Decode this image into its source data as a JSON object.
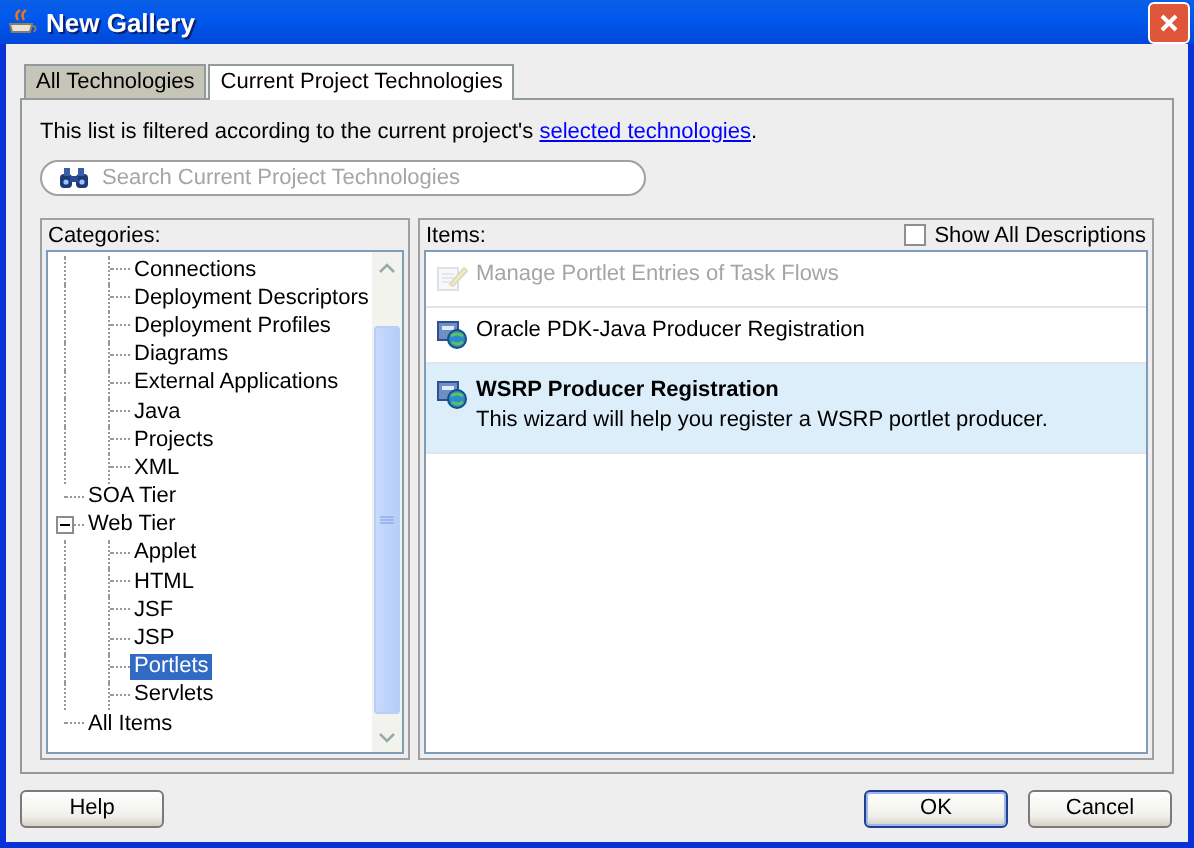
{
  "window": {
    "title": "New Gallery"
  },
  "tabs": [
    {
      "label": "All Technologies",
      "selected": false
    },
    {
      "label": "Current Project Technologies",
      "selected": true
    }
  ],
  "filter_note": {
    "text": "This list is filtered according to the current project's ",
    "link": "selected technologies",
    "end": "."
  },
  "search": {
    "placeholder": "Search Current Project Technologies"
  },
  "categories": {
    "label": "Categories:",
    "tree": [
      {
        "children": [
          {
            "label": "Connections",
            "selected": false
          },
          {
            "label": "Deployment Descriptors",
            "selected": false
          },
          {
            "label": "Deployment Profiles",
            "selected": false
          },
          {
            "label": "Diagrams",
            "selected": false
          },
          {
            "label": "External Applications",
            "selected": false
          },
          {
            "label": "Java",
            "selected": false
          },
          {
            "label": "Projects",
            "selected": false
          },
          {
            "label": "XML",
            "selected": false
          }
        ]
      },
      {
        "label": "SOA Tier",
        "selected": false
      },
      {
        "label": "Web Tier",
        "selected": false,
        "expanded": true,
        "children": [
          {
            "label": "Applet",
            "selected": false
          },
          {
            "label": "HTML",
            "selected": false
          },
          {
            "label": "JSF",
            "selected": false
          },
          {
            "label": "JSP",
            "selected": false
          },
          {
            "label": "Portlets",
            "selected": true
          },
          {
            "label": "Servlets",
            "selected": false
          }
        ]
      },
      {
        "label": "All Items",
        "selected": false
      }
    ]
  },
  "items": {
    "label": "Items:",
    "show_all_descriptions": {
      "label": "Show All Descriptions",
      "checked": false
    },
    "list": [
      {
        "kind": "task",
        "title": "Manage Portlet Entries of Task Flows",
        "disabled": true,
        "selected": false
      },
      {
        "kind": "producer",
        "title": "Oracle PDK-Java Producer Registration",
        "disabled": false,
        "selected": false
      },
      {
        "kind": "producer",
        "title": "WSRP Producer Registration",
        "description": "This wizard will help you register a WSRP portlet producer.",
        "disabled": false,
        "selected": true
      }
    ]
  },
  "buttons": [
    {
      "kind": "help",
      "label": "Help"
    },
    {
      "kind": "ok",
      "label": "OK",
      "default": true
    },
    {
      "kind": "cancel",
      "label": "Cancel",
      "default": false
    }
  ]
}
